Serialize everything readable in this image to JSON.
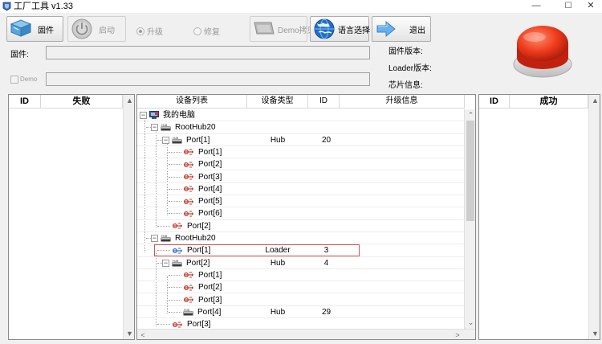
{
  "window": {
    "title": "工厂工具 v1.33",
    "controls": {
      "minimize": "—",
      "maximize": "☐",
      "close": "✕"
    }
  },
  "toolbar": {
    "firmware_label": "固件",
    "start_label": "启动",
    "radio_upgrade": "升级",
    "radio_repair": "修复",
    "demo_copy_label": "Demo拷贝",
    "language_label": "语言选择",
    "exit_label": "退出"
  },
  "info": {
    "firmware_field_label": "固件:",
    "demo_checkbox_label": "Demo",
    "firmware_version_label": "固件版本:",
    "loader_version_label": "Loader版本:",
    "chip_info_label": "芯片信息:"
  },
  "fail_panel": {
    "col_id": "ID",
    "col_status": "失败"
  },
  "success_panel": {
    "col_id": "ID",
    "col_status": "成功"
  },
  "device_panel": {
    "columns": [
      "设备列表",
      "设备类型",
      "ID",
      "升级信息"
    ],
    "rows": [
      {
        "name": "我的电脑",
        "type": "",
        "id": "",
        "icon": "computer",
        "level": 0,
        "expander": "⊟"
      },
      {
        "name": "RootHub20",
        "type": "",
        "id": "",
        "icon": "hub",
        "level": 1,
        "expander": "⊟"
      },
      {
        "name": "Port[1]",
        "type": "Hub",
        "id": "20",
        "icon": "hub",
        "level": 2,
        "expander": "⊟"
      },
      {
        "name": "Port[1]",
        "type": "",
        "id": "",
        "icon": "usb",
        "level": 3,
        "expander": ""
      },
      {
        "name": "Port[2]",
        "type": "",
        "id": "",
        "icon": "usb",
        "level": 3,
        "expander": ""
      },
      {
        "name": "Port[3]",
        "type": "",
        "id": "",
        "icon": "usb",
        "level": 3,
        "expander": ""
      },
      {
        "name": "Port[4]",
        "type": "",
        "id": "",
        "icon": "usb",
        "level": 3,
        "expander": ""
      },
      {
        "name": "Port[5]",
        "type": "",
        "id": "",
        "icon": "usb",
        "level": 3,
        "expander": ""
      },
      {
        "name": "Port[6]",
        "type": "",
        "id": "",
        "icon": "usb",
        "level": 3,
        "expander": ""
      },
      {
        "name": "Port[2]",
        "type": "",
        "id": "",
        "icon": "usb",
        "level": 2,
        "expander": ""
      },
      {
        "name": "RootHub20",
        "type": "",
        "id": "",
        "icon": "hub",
        "level": 1,
        "expander": "⊟"
      },
      {
        "name": "Port[1]",
        "type": "Loader",
        "id": "3",
        "icon": "usb-blue",
        "level": 2,
        "expander": ""
      },
      {
        "name": "Port[2]",
        "type": "Hub",
        "id": "4",
        "icon": "hub",
        "level": 2,
        "expander": "⊟"
      },
      {
        "name": "Port[1]",
        "type": "",
        "id": "",
        "icon": "usb",
        "level": 3,
        "expander": ""
      },
      {
        "name": "Port[2]",
        "type": "",
        "id": "",
        "icon": "usb",
        "level": 3,
        "expander": ""
      },
      {
        "name": "Port[3]",
        "type": "",
        "id": "",
        "icon": "usb",
        "level": 3,
        "expander": ""
      },
      {
        "name": "Port[4]",
        "type": "Hub",
        "id": "29",
        "icon": "hub",
        "level": 3,
        "expander": ""
      },
      {
        "name": "Port[3]",
        "type": "",
        "id": "",
        "icon": "usb",
        "level": 2,
        "expander": ""
      }
    ]
  },
  "colors": {
    "accent_red": "#e0301e",
    "selection_border": "#d9534f"
  }
}
